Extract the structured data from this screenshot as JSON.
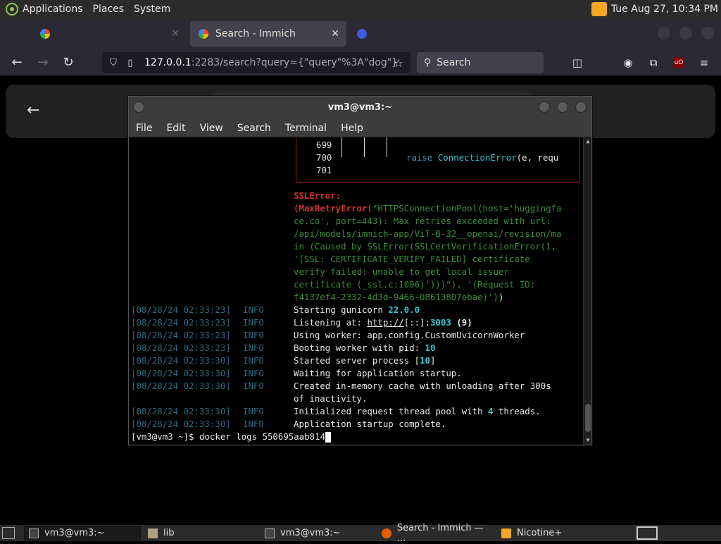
{
  "top_panel": {
    "menus": [
      "Applications",
      "Places",
      "System"
    ],
    "clock": "Tue Aug 27, 10:34 PM"
  },
  "browser": {
    "tabs": [
      {
        "label": "",
        "active": false
      },
      {
        "label": "Search - Immich",
        "active": true
      },
      {
        "label": "",
        "active": false
      }
    ],
    "url_host": "127.0.0.1",
    "url_rest": ":2283/search?query={\"query\"%3A\"dog\"}",
    "search_placeholder": "Search",
    "ublock_label": "uO"
  },
  "terminal": {
    "title": "vm3@vm3:~",
    "menus": [
      "File",
      "Edit",
      "View",
      "Search",
      "Terminal",
      "Help"
    ],
    "trace_lines": {
      "l699": "699",
      "l700": "700",
      "l700_code_kw": "raise ",
      "l700_code_cls": "ConnectionError",
      "l700_code_rest": "(e, requ",
      "l701": "701"
    },
    "ssl_error_title": "SSLError:",
    "ssl_error_body": [
      {
        "red": "(MaxRetryError(",
        "grn": "\"HTTPSConnectionPool(host='huggingfa"
      },
      {
        "grn": "ce.co', port=443): Max retries exceeded with url:"
      },
      {
        "grn": "/api/models/immich-app/ViT-B-32__openai/revision/ma"
      },
      {
        "grn": "in (Caused by SSLError(SSLCertVerificationError(1,"
      },
      {
        "grn": "'[SSL: CERTIFICATE_VERIFY_FAILED] certificate"
      },
      {
        "grn": "verify failed: unable to get local issuer"
      },
      {
        "grn": "certificate (_ssl.c:1006)')))\"), ",
        "w": "'(Request ID:"
      },
      {
        "grn": "f4137ef4-2332-4d3d-9466-08613807ebae)')",
        "w": ")"
      }
    ],
    "log": [
      {
        "ts": "[08/28/24 02:33:23]",
        "lvl": "INFO",
        "pre": "Starting gunicorn ",
        "num": "22.0.0",
        "post": ""
      },
      {
        "ts": "[08/28/24 02:33:23]",
        "lvl": "INFO",
        "pre": "Listening at: ",
        "link": "http://",
        "mid": "[::]:",
        "num": "3003",
        "post": " (9)"
      },
      {
        "ts": "[08/28/24 02:33:23]",
        "lvl": "INFO",
        "pre": "Using worker: app.config.CustomUvicornWorker",
        "num": "",
        "post": ""
      },
      {
        "ts": "[08/28/24 02:33:23]",
        "lvl": "INFO",
        "pre": "Booting worker with pid: ",
        "num": "10",
        "post": ""
      },
      {
        "ts": "[08/28/24 02:33:30]",
        "lvl": "INFO",
        "pre": "Started server process [",
        "num": "10",
        "post": "]"
      },
      {
        "ts": "[08/28/24 02:33:30]",
        "lvl": "INFO",
        "pre": "Waiting for application startup.",
        "num": "",
        "post": ""
      },
      {
        "ts": "[08/28/24 02:33:30]",
        "lvl": "INFO",
        "pre": "Created in-memory cache with unloading after 300s",
        "num": "",
        "post": ""
      },
      {
        "ts": "",
        "lvl": "",
        "pre": "of inactivity.",
        "num": "",
        "post": ""
      },
      {
        "ts": "[08/28/24 02:33:30]",
        "lvl": "INFO",
        "pre": "Initialized request thread pool with ",
        "num": "4",
        "post": " threads."
      },
      {
        "ts": "[08/28/24 02:33:30]",
        "lvl": "INFO",
        "pre": "Application startup complete.",
        "num": "",
        "post": ""
      }
    ],
    "prompt": "[vm3@vm3 ~]$ docker logs 550695aab814"
  },
  "taskbar": {
    "items": [
      "vm3@vm3:~",
      "lib",
      "vm3@vm3:~",
      "Search - Immich — ...",
      "Nicotine+"
    ]
  },
  "colors": {
    "terminal_red": "#d03030",
    "terminal_green": "#3a8e3a",
    "terminal_cyan": "#3ac4d4",
    "timestamp": "#2b6a7c"
  }
}
